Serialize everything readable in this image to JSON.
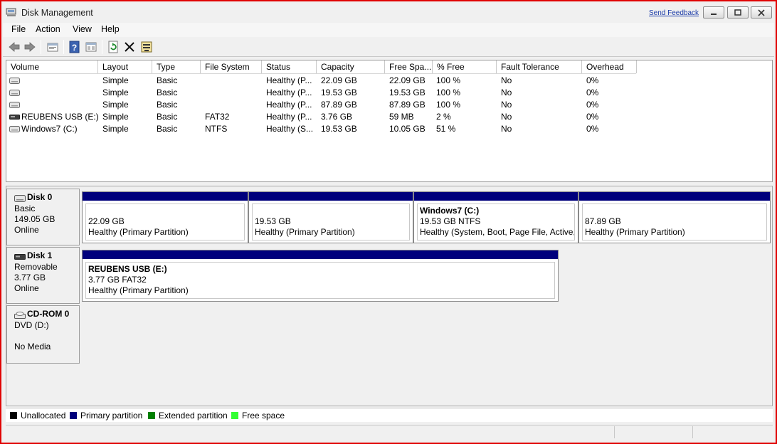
{
  "window": {
    "title": "Disk Management",
    "feedback_link": "Send Feedback"
  },
  "menu": [
    "File",
    "Action",
    "View",
    "Help"
  ],
  "toolbar": [
    "back-icon",
    "forward-icon",
    "properties-icon",
    "help-icon",
    "view-icon",
    "refresh-icon",
    "delete-icon",
    "rescan-icon"
  ],
  "volume_table": {
    "columns": [
      "Volume",
      "Layout",
      "Type",
      "File System",
      "Status",
      "Capacity",
      "Free Spa...",
      "% Free",
      "Fault Tolerance",
      "Overhead"
    ],
    "rows": [
      {
        "volume": "",
        "layout": "Simple",
        "type": "Basic",
        "fs": "",
        "status": "Healthy (P...",
        "capacity": "22.09 GB",
        "free": "22.09 GB",
        "pct": "100 %",
        "fault": "No",
        "overhead": "0%"
      },
      {
        "volume": "",
        "layout": "Simple",
        "type": "Basic",
        "fs": "",
        "status": "Healthy (P...",
        "capacity": "19.53 GB",
        "free": "19.53 GB",
        "pct": "100 %",
        "fault": "No",
        "overhead": "0%"
      },
      {
        "volume": "",
        "layout": "Simple",
        "type": "Basic",
        "fs": "",
        "status": "Healthy (P...",
        "capacity": "87.89 GB",
        "free": "87.89 GB",
        "pct": "100 %",
        "fault": "No",
        "overhead": "0%"
      },
      {
        "volume": "REUBENS USB (E:)",
        "layout": "Simple",
        "type": "Basic",
        "fs": "FAT32",
        "status": "Healthy (P...",
        "capacity": "3.76 GB",
        "free": "59 MB",
        "pct": "2 %",
        "fault": "No",
        "overhead": "0%"
      },
      {
        "volume": "Windows7 (C:)",
        "layout": "Simple",
        "type": "Basic",
        "fs": "NTFS",
        "status": "Healthy (S...",
        "capacity": "19.53 GB",
        "free": "10.05 GB",
        "pct": "51 %",
        "fault": "No",
        "overhead": "0%"
      }
    ]
  },
  "disks": [
    {
      "name": "Disk 0",
      "type": "Basic",
      "size": "149.05 GB",
      "state": "Online",
      "partitions": [
        {
          "label": "",
          "size": "22.09 GB",
          "status": "Healthy (Primary Partition)"
        },
        {
          "label": "",
          "size": "19.53 GB",
          "status": "Healthy (Primary Partition)"
        },
        {
          "label": "Windows7  (C:)",
          "size": "19.53 GB NTFS",
          "status": "Healthy (System, Boot, Page File, Active, Crash Dump, Primary Partition)"
        },
        {
          "label": "",
          "size": "87.89 GB",
          "status": "Healthy (Primary Partition)"
        }
      ]
    },
    {
      "name": "Disk 1",
      "type": "Removable",
      "size": "3.77 GB",
      "state": "Online",
      "partitions": [
        {
          "label": "REUBENS USB  (E:)",
          "size": "3.77 GB FAT32",
          "status": "Healthy (Primary Partition)"
        }
      ]
    },
    {
      "name": "CD-ROM 0",
      "type": "DVD (D:)",
      "size": "",
      "state": "No Media",
      "partitions": []
    }
  ],
  "legend": [
    {
      "label": "Unallocated",
      "color": "#000000"
    },
    {
      "label": "Primary partition",
      "color": "#00007c"
    },
    {
      "label": "Extended partition",
      "color": "#008000"
    },
    {
      "label": "Free space",
      "color": "#33ff33"
    }
  ],
  "colors": {
    "window_border": "#e00000",
    "partition_bar": "#00007c"
  }
}
